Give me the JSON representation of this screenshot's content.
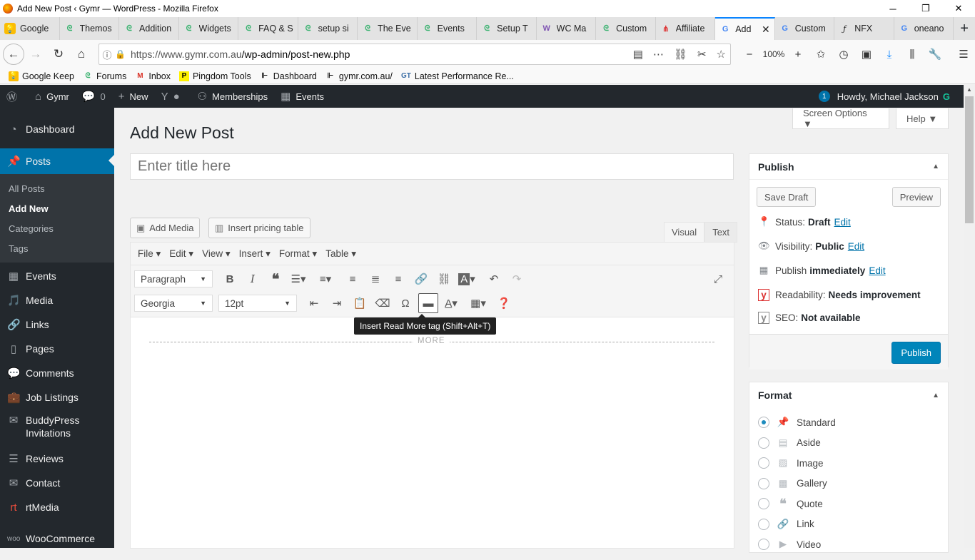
{
  "window": {
    "title": "Add New Post ‹ Gymr — WordPress - Mozilla Firefox"
  },
  "tabs": [
    {
      "label": "Google",
      "icon": "keep"
    },
    {
      "label": "Themos",
      "icon": "ws"
    },
    {
      "label": "Addition",
      "icon": "ws"
    },
    {
      "label": "Widgets",
      "icon": "ws"
    },
    {
      "label": "FAQ & S",
      "icon": "ws"
    },
    {
      "label": "setup si",
      "icon": "ws"
    },
    {
      "label": "The Eve",
      "icon": "ws"
    },
    {
      "label": "Events",
      "icon": "ws"
    },
    {
      "label": "Setup T",
      "icon": "ws"
    },
    {
      "label": "WC Ma",
      "icon": "wc"
    },
    {
      "label": "Custom",
      "icon": "ws"
    },
    {
      "label": "Affiliate",
      "icon": "af"
    },
    {
      "label": "Add",
      "icon": "g",
      "active": true
    },
    {
      "label": "Custom",
      "icon": "g"
    },
    {
      "label": "NFX",
      "icon": "f"
    },
    {
      "label": "oneano",
      "icon": "g"
    }
  ],
  "nav": {
    "url_host": "https://www.gymr.com.au",
    "url_path": "/wp-admin/post-new.php",
    "zoom": "100%"
  },
  "bookmarks": [
    "Google Keep",
    "Forums",
    "Inbox",
    "Pingdom Tools",
    "Dashboard",
    "gymr.com.au/",
    "Latest Performance Re..."
  ],
  "adminbar": {
    "site": "Gymr",
    "comments": "0",
    "new": "New",
    "memberships": "Memberships",
    "events": "Events",
    "notif": "1",
    "howdy": "Howdy, Michael Jackson"
  },
  "sidebar": {
    "dashboard": "Dashboard",
    "posts": "Posts",
    "sub": [
      "All Posts",
      "Add New",
      "Categories",
      "Tags"
    ],
    "items": [
      "Events",
      "Media",
      "Links",
      "Pages",
      "Comments",
      "Job Listings",
      "BuddyPress Invitations",
      "Reviews",
      "Contact",
      "rtMedia",
      "WooCommerce"
    ]
  },
  "page": {
    "title": "Add New Post",
    "screen_options": "Screen Options ▼",
    "help": "Help ▼",
    "title_placeholder": "Enter title here"
  },
  "editor": {
    "add_media": "Add Media",
    "insert_pricing": "Insert pricing table",
    "tab_visual": "Visual",
    "tab_text": "Text",
    "menus": [
      "File ▾",
      "Edit ▾",
      "View ▾",
      "Insert ▾",
      "Format ▾",
      "Table ▾"
    ],
    "paragraph": "Paragraph",
    "font": "Georgia",
    "size": "12pt",
    "tooltip": "Insert Read More tag (Shift+Alt+T)",
    "more": "MORE"
  },
  "publish": {
    "title": "Publish",
    "save_draft": "Save Draft",
    "preview": "Preview",
    "status_label": "Status:",
    "status": "Draft",
    "visibility_label": "Visibility:",
    "visibility": "Public",
    "publish_label": "Publish",
    "publish_when": "immediately",
    "edit": "Edit",
    "readability_label": "Readability:",
    "readability": "Needs improvement",
    "seo_label": "SEO:",
    "seo": "Not available",
    "publish_btn": "Publish"
  },
  "format": {
    "title": "Format",
    "options": [
      "Standard",
      "Aside",
      "Image",
      "Gallery",
      "Quote",
      "Link",
      "Video"
    ]
  }
}
